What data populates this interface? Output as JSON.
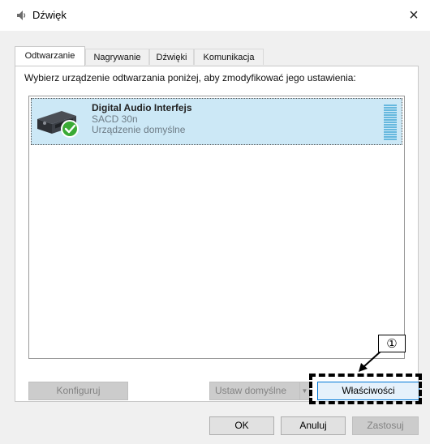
{
  "window": {
    "title": "Dźwięk",
    "close_glyph": "×"
  },
  "tabs": [
    "Odtwarzanie",
    "Nagrywanie",
    "Dźwięki",
    "Komunikacja"
  ],
  "instruction": "Wybierz urządzenie odtwarzania poniżej, aby zmodyfikować jego ustawienia:",
  "device": {
    "name": "Digital Audio Interfejs",
    "model": "SACD 30n",
    "status": "Urządzenie domyślne",
    "icon": "audio-device-icon",
    "badge_icon": "check-circle-icon",
    "badge_color": "#3aaa35"
  },
  "buttons": {
    "configure": "Konfiguruj",
    "set_default": "Ustaw domyślne",
    "properties": "Właściwości",
    "ok": "OK",
    "cancel": "Anuluj",
    "apply": "Zastosuj"
  },
  "annotation": {
    "label": "①"
  },
  "colors": {
    "selection": "#cce8f6",
    "meter": "#66b8de",
    "focus_border": "#0078d7"
  }
}
